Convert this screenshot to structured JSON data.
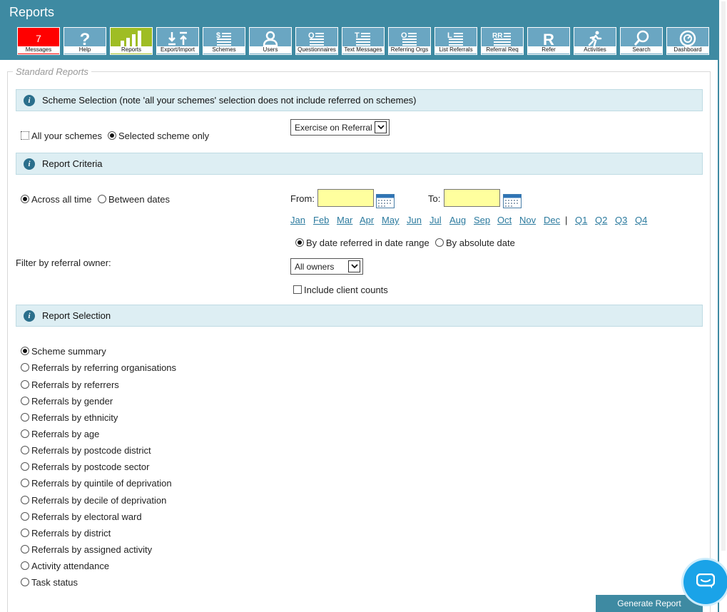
{
  "app": {
    "title": "Reports"
  },
  "toolbar": [
    {
      "label": "Messages",
      "badge": "7",
      "icon": "messages-badge"
    },
    {
      "label": "Help",
      "icon": "help-icon"
    },
    {
      "label": "Reports",
      "icon": "bar-chart-icon"
    },
    {
      "label": "Export/Import",
      "icon": "export-import-icon"
    },
    {
      "label": "Schemes",
      "icon": "schemes-icon"
    },
    {
      "label": "Users",
      "icon": "user-icon"
    },
    {
      "label": "Questionnaires",
      "icon": "questionnaire-icon"
    },
    {
      "label": "Text Messages",
      "icon": "text-message-icon"
    },
    {
      "label": "Referring Orgs",
      "icon": "orgs-icon"
    },
    {
      "label": "List Referrals",
      "icon": "list-icon"
    },
    {
      "label": "Referral Req",
      "icon": "referral-req-icon"
    },
    {
      "label": "Refer",
      "icon": "refer-icon"
    },
    {
      "label": "Activities",
      "icon": "running-icon"
    },
    {
      "label": "Search",
      "icon": "search-icon"
    },
    {
      "label": "Dashboard",
      "icon": "dashboard-icon"
    }
  ],
  "legend": "Standard Reports",
  "scheme_section": {
    "title": "Scheme Selection (note 'all your schemes' selection does not include referred on schemes)",
    "all_schemes": "All your schemes",
    "selected_only": "Selected scheme only",
    "scheme_value": "Exercise on Referral"
  },
  "criteria_section": {
    "title": "Report Criteria",
    "all_time": "Across all time",
    "between": "Between dates",
    "from": "From:",
    "to": "To:",
    "months": [
      "Jan",
      "Feb",
      "Mar",
      "Apr",
      "May",
      "Jun",
      "Jul",
      "Aug",
      "Sep",
      "Oct",
      "Nov",
      "Dec"
    ],
    "separator": "|",
    "quarters": [
      "Q1",
      "Q2",
      "Q3",
      "Q4"
    ],
    "by_date_referred": "By date referred in date range",
    "by_absolute": "By absolute date",
    "filter_label": "Filter by referral owner:",
    "owner_value": "All owners",
    "include_counts": "Include client counts"
  },
  "selection_section": {
    "title": "Report Selection",
    "options": [
      "Scheme summary",
      "Referrals by referring organisations",
      "Referrals by referrers",
      "Referrals by gender",
      "Referrals by ethnicity",
      "Referrals by age",
      "Referrals by postcode district",
      "Referrals by postcode sector",
      "Referrals by quintile of deprivation",
      "Referrals by decile of deprivation",
      "Referrals by electoral ward",
      "Referrals by district",
      "Referrals by assigned activity",
      "Activity attendance",
      "Task status"
    ]
  },
  "generate_button": "Generate Report"
}
